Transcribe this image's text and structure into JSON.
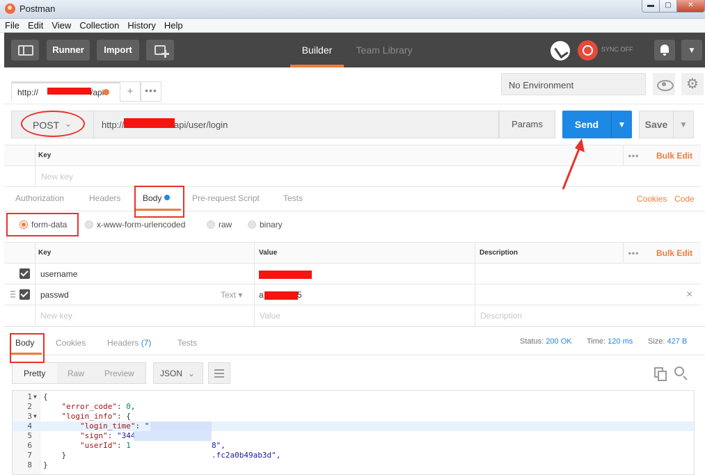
{
  "window": {
    "title": "Postman",
    "min": "0",
    "max": "1",
    "close": "r"
  },
  "menu": [
    "File",
    "Edit",
    "View",
    "Collection",
    "History",
    "Help"
  ],
  "toolbar": {
    "runner": "Runner",
    "import": "Import",
    "tabs": {
      "builder": "Builder",
      "team_library": "Team Library"
    },
    "sync_label": "SYNC OFF",
    "icons": {
      "sidebar": "sidebar-toggle-icon",
      "new_window": "new-window-icon",
      "satellite": "satellite-icon",
      "sync": "sync-icon",
      "bell": "bell-icon",
      "menu": "chevron-down-icon"
    }
  },
  "request_tab": {
    "url_prefix": "http://",
    "url_suffix": "/api",
    "add": "+",
    "more": "•••"
  },
  "environment": {
    "selected": "No Environment"
  },
  "url_bar": {
    "method": "POST",
    "url_prefix": "http://",
    "url_suffix": "api/user/login",
    "params": "Params",
    "send": "Send",
    "save": "Save"
  },
  "params_table": {
    "key_header": "Key",
    "bulk_edit": "Bulk Edit",
    "new_key_placeholder": "New key"
  },
  "request_tabs": {
    "items": [
      "Authorization",
      "Headers",
      "Body",
      "Pre-request Script",
      "Tests"
    ],
    "active": "Body",
    "cookies": "Cookies",
    "code": "Code"
  },
  "body_modes": {
    "options": [
      "form-data",
      "x-www-form-urlencoded",
      "raw",
      "binary"
    ],
    "selected": "form-data"
  },
  "form_table": {
    "headers": {
      "key": "Key",
      "value": "Value",
      "description": "Description"
    },
    "bulk_edit": "Bulk Edit",
    "rows": [
      {
        "key": "username",
        "checked": true
      },
      {
        "key": "passwd",
        "type": "Text",
        "value_prefix": "a",
        "value_suffix": "5",
        "checked": true
      }
    ],
    "placeholders": {
      "key": "New key",
      "value": "Value",
      "description": "Description"
    },
    "remove": "×"
  },
  "response_tabs": {
    "items": [
      "Body",
      "Cookies",
      "Headers",
      "Tests"
    ],
    "headers_count": "(7)",
    "active": "Body"
  },
  "status": {
    "status_label": "Status:",
    "status_value": "200 OK",
    "time_label": "Time:",
    "time_value": "120 ms",
    "size_label": "Size:",
    "size_value": "427 B"
  },
  "response_view": {
    "modes": [
      "Pretty",
      "Raw",
      "Preview"
    ],
    "active": "Pretty",
    "format": "JSON"
  },
  "code_lines": [
    "{",
    "    \"error_code\": 0,",
    "    \"login_info\": {",
    "        \"login_time\": \"",
    "        \"sign\": \"344",
    "        \"userId\": 1",
    "    }",
    "}"
  ],
  "code_fragments": {
    "login_time_tail": "8\",",
    "sign_tail": ".fc2a0b49ab3d\","
  },
  "colors": {
    "accent": "#f07c3d",
    "send_blue": "#1e88e5",
    "toolbar_bg": "#464646",
    "annotation_red": "#e8322a"
  }
}
